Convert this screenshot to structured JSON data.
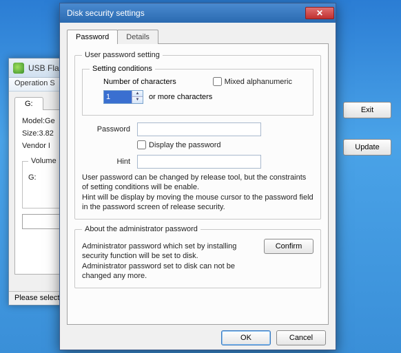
{
  "bg": {
    "title": "USB Flash S",
    "menu": "Operation   S",
    "tabLabel": "G:",
    "model": "Model:Ge",
    "size": "Size:3.82",
    "vendor": "Vendor I",
    "volumeLegend": "Volume",
    "volumeItem": "G:",
    "status": "Please select a d",
    "btnExit": "Exit",
    "btnUpdate": "Update",
    "winMin": "—",
    "winMax": "☐",
    "winClose": "✕"
  },
  "dialog": {
    "title": "Disk security settings",
    "tabs": {
      "password": "Password",
      "details": "Details"
    },
    "group1": {
      "legend": "User password setting",
      "inner": {
        "legend": "Setting conditions",
        "numCharsLabel": "Number of characters",
        "numCharsValue": "1",
        "orMore": "or more characters",
        "mixed": "Mixed alphanumeric"
      },
      "passwordLabel": "Password",
      "displayPassword": "Display the password",
      "hintLabel": "Hint",
      "note": "User password can be changed by release tool, but the constraints of setting conditions will be enable.\nHint will be display by moving the mouse cursor to the password field in the password screen of release security."
    },
    "group2": {
      "legend": "About the administrator password",
      "note": "Administrator password which set by installing security function will be set to disk.\nAdministrator password set to disk can not be changed any more.",
      "confirm": "Confirm"
    },
    "ok": "OK",
    "cancel": "Cancel"
  }
}
